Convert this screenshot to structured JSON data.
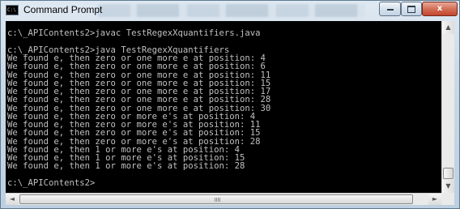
{
  "window": {
    "title": "Command Prompt",
    "icon": "cmd-icon",
    "controls": [
      "minimize-icon",
      "maximize-icon",
      "close-icon"
    ],
    "close_glyph": "x"
  },
  "console": {
    "colors": {
      "background": "#000000",
      "text": "#c0c0c0"
    },
    "lines": [
      "",
      "c:\\_APIContents2>javac TestRegexXquantifiers.java",
      "",
      "c:\\_APIContents2>java TestRegexXquantifiers",
      "We found e, then zero or one more e at position: 4",
      "We found e, then zero or one more e at position: 6",
      "We found e, then zero or one more e at position: 11",
      "We found e, then zero or one more e at position: 15",
      "We found e, then zero or one more e at position: 17",
      "We found e, then zero or one more e at position: 28",
      "We found e, then zero or one more e at position: 30",
      "We found e, then zero or more e's at position: 4",
      "We found e, then zero or more e's at position: 11",
      "We found e, then zero or more e's at position: 15",
      "We found e, then zero or more e's at position: 28",
      "We found e, then 1 or more e's at position: 4",
      "We found e, then 1 or more e's at position: 15",
      "We found e, then 1 or more e's at position: 28",
      "",
      "c:\\_APIContents2>"
    ]
  },
  "scrollbars": {
    "up_arrow": "▲",
    "down_arrow": "▼",
    "left_arrow": "◄",
    "right_arrow": "►"
  }
}
